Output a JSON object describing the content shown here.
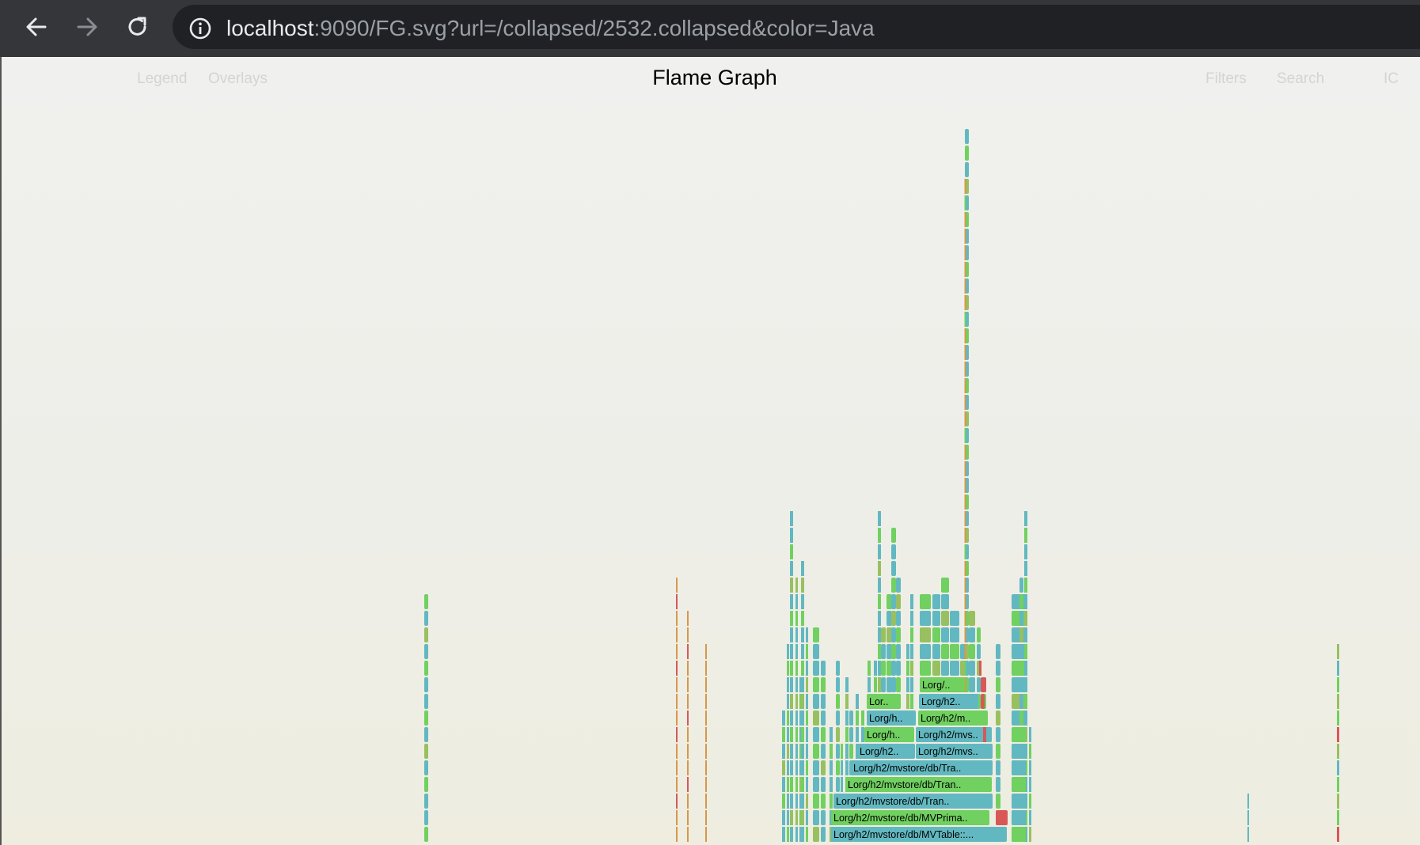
{
  "browser": {
    "url_host": "localhost",
    "url_rest": ":9090/FG.svg?url=/collapsed/2532.collapsed&color=Java",
    "icons": [
      "back-arrow-icon",
      "forward-arrow-icon",
      "reload-icon",
      "info-icon"
    ]
  },
  "graph": {
    "title": "Flame Graph",
    "menu_left": [
      "Legend",
      "Overlays"
    ],
    "menu_right": [
      "Filters",
      "Search",
      "IC"
    ],
    "frame_labels": [
      "Lorg/h2/mvstore/db/MVTable::...",
      "Lorg/h2/mvstore/db/MVPrima..",
      "Lorg/h2/mvstore/db/Tran..",
      "Lorg/h2/mvstore/db/Tran..",
      "Lorg/h2/mvstore/db/Tra..",
      "Lorg/h2..",
      "Lorg/h2/mvs..",
      "Lorg/h..",
      "Lorg/h2/mvs..",
      "Lorg/h..",
      "Lorg/h2/m..",
      "Lor..",
      "Lorg/h2..",
      "Lorg/.."
    ],
    "palette": {
      "teal": "#62b8c0",
      "green": "#70d060",
      "orange": "#d89848",
      "red": "#d85858",
      "olive": "#98c060"
    }
  }
}
